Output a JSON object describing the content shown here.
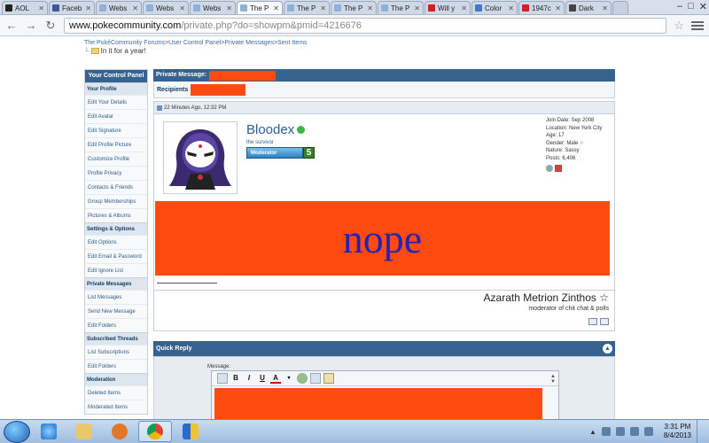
{
  "browser": {
    "tabs": [
      {
        "label": "AOL",
        "active": false,
        "icon_color": "#222222"
      },
      {
        "label": "Faceb",
        "active": false,
        "icon_color": "#3b5998"
      },
      {
        "label": "Webs",
        "active": false,
        "icon_color": "#8fb0d8"
      },
      {
        "label": "Webs",
        "active": false,
        "icon_color": "#8fb0d8"
      },
      {
        "label": "Webs",
        "active": false,
        "icon_color": "#8fb0d8"
      },
      {
        "label": "The P",
        "active": true,
        "icon_color": "#8fb0d8"
      },
      {
        "label": "The P",
        "active": false,
        "icon_color": "#8fb0d8"
      },
      {
        "label": "The P",
        "active": false,
        "icon_color": "#8fb0d8"
      },
      {
        "label": "The P",
        "active": false,
        "icon_color": "#8fb0d8"
      },
      {
        "label": "Will y",
        "active": false,
        "icon_color": "#cc2222"
      },
      {
        "label": "Color",
        "active": false,
        "icon_color": "#3a7ad0"
      },
      {
        "label": "1947c",
        "active": false,
        "icon_color": "#cc2222"
      },
      {
        "label": "Dark",
        "active": false,
        "icon_color": "#444444"
      }
    ],
    "url_host": "www.pokecommunity.com",
    "url_path": "/private.php?do=showpm&pmid=4216676"
  },
  "breadcrumb": {
    "items": [
      "The PokéCommunity Forums",
      "User Control Panel",
      "Private Messages",
      "Sent Items"
    ],
    "separator": ">"
  },
  "page_subtitle": "In it for a year!",
  "sidebar": {
    "title": "Your Control Panel",
    "sections": [
      {
        "title": "Your Profile",
        "items": [
          "Edit Your Details",
          "Edit Avatar",
          "Edit Signature",
          "Edit Profile Picture",
          "Customize Profile",
          "Profile Privacy",
          "Contacts & Friends",
          "Group Memberships",
          "Pictures & Albums"
        ]
      },
      {
        "title": "Settings & Options",
        "items": [
          "Edit Options",
          "Edit Email & Password",
          "Edit Ignore List"
        ]
      },
      {
        "title": "Private Messages",
        "items": [
          "List Messages",
          "Send New Message",
          "Edit Folders"
        ]
      },
      {
        "title": "Subscribed Threads",
        "items": [
          "List Subscriptions",
          "Edit Folders"
        ]
      },
      {
        "title": "Moderation",
        "items": [
          "Deleted Items",
          "Moderated Items"
        ]
      }
    ]
  },
  "message": {
    "header_label": "Private Message:",
    "recipients_label": "Recipients",
    "date": "22 Minutes Ago, 12:32 PM",
    "username": "Bloodex",
    "user_title": "the survivor",
    "badge_label": "Moderator",
    "badge_number": "5",
    "info": [
      "Join Date: Sep 2008",
      "Location: New York City",
      "Age: 17",
      "Gender: Male ♂",
      "Nature: Sassy",
      "Posts: 6,406"
    ],
    "body_text": "nope",
    "signature_name": "Azarath Metrion Zinthos ☆",
    "signature_sub": "moderator of chit chat & polls"
  },
  "quick_reply": {
    "title": "Quick Reply",
    "message_label": "Message:",
    "toolbar": [
      "B",
      "I",
      "U",
      "A"
    ]
  },
  "colors": {
    "header_blue": "#35628e",
    "redaction": "#ff4a10",
    "nope_text": "#2323b8"
  },
  "taskbar": {
    "time": "3:31 PM",
    "date": "8/4/2013"
  }
}
